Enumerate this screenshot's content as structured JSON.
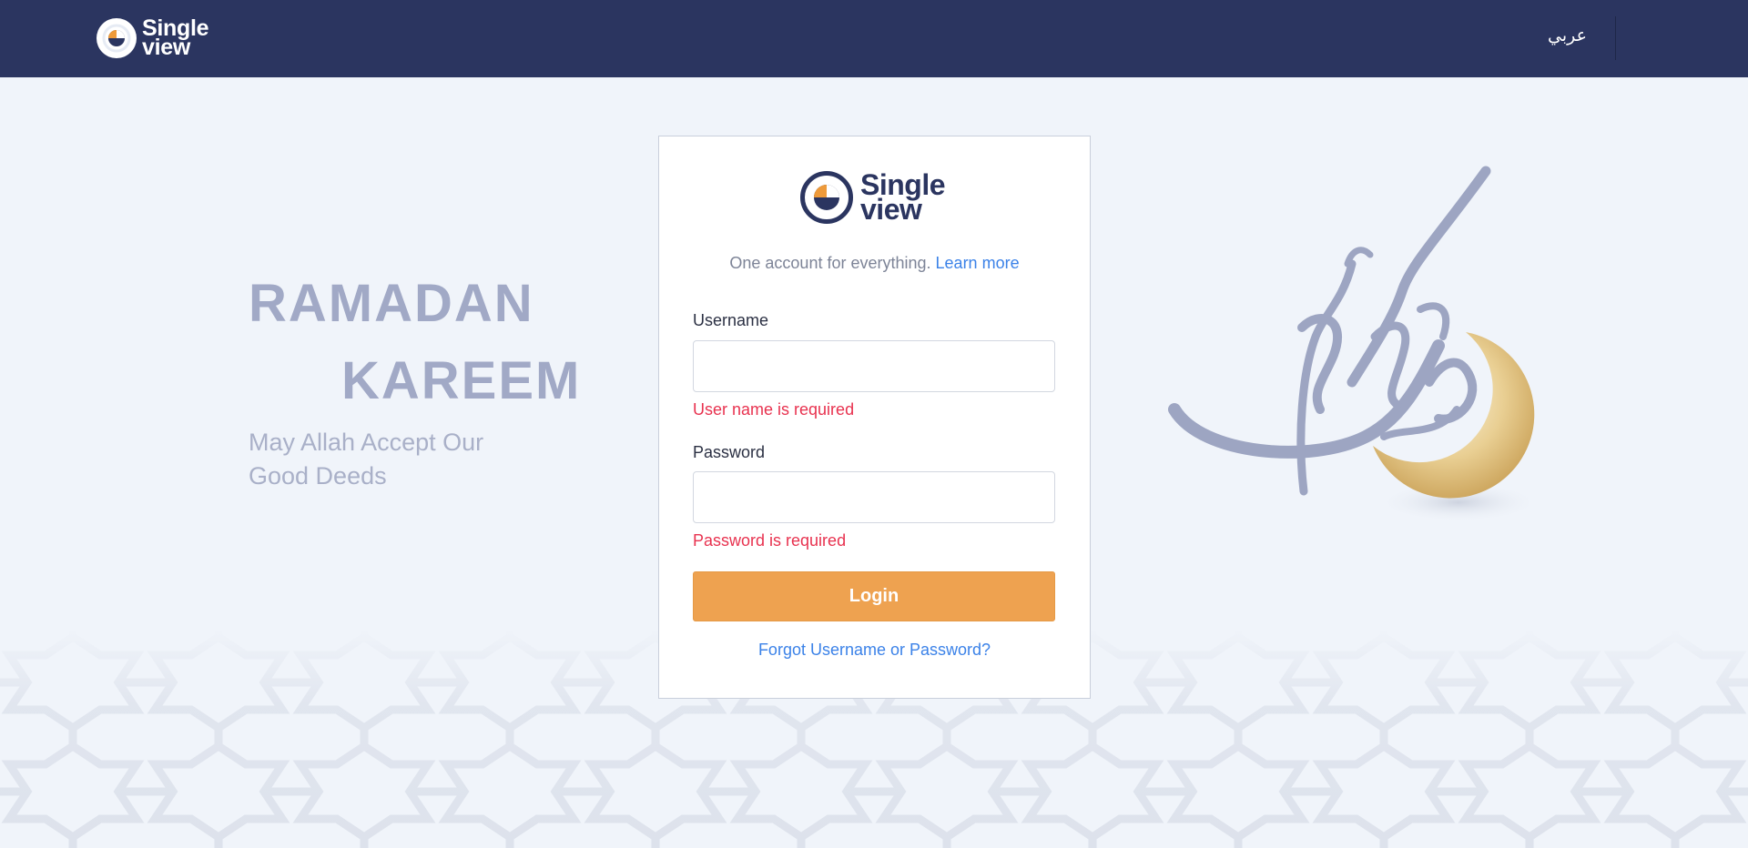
{
  "header": {
    "brand_line1": "Single",
    "brand_line2": "view",
    "language_toggle": "عربي"
  },
  "banner": {
    "word1": "RAMADAN",
    "word2": "KAREEM",
    "subtitle": "May Allah Accept Our Good Deeds"
  },
  "login": {
    "logo_line1": "Single",
    "logo_line2": "view",
    "tagline": "One account for everything.",
    "learn_more": "Learn more",
    "username_label": "Username",
    "username_value": "",
    "username_error": "User name is required",
    "password_label": "Password",
    "password_value": "",
    "password_error": "Password is required",
    "login_button": "Login",
    "forgot_link": "Forgot Username or Password?"
  },
  "colors": {
    "header_bg": "#2b3560",
    "accent_orange": "#eea250",
    "link_blue": "#3b82e8",
    "error_red": "#e8324f"
  }
}
